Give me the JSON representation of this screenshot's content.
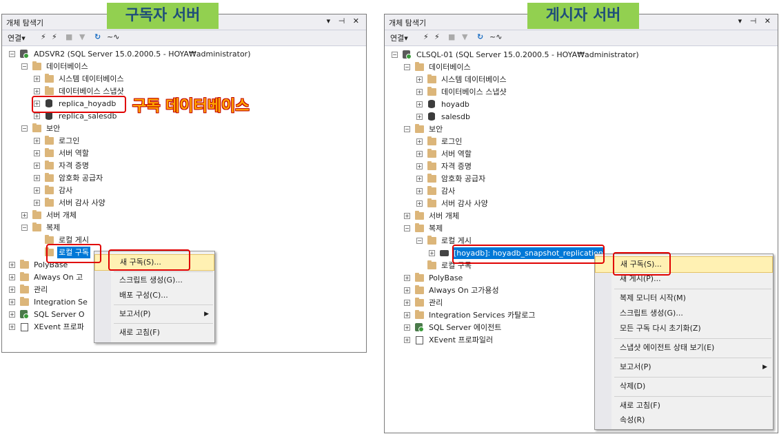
{
  "panel_title": "개체 탐색기",
  "panel_buttons": "▾ ⊣ ✕",
  "toolbar": {
    "connect": "연결▾",
    "icon1": "⚡",
    "icon2": "⚡",
    "refresh": "↻",
    "activity": "~∿"
  },
  "left": {
    "banner": "구독자 서버",
    "annotation": "구독 데이터베이스",
    "server": "ADSVR2 (SQL Server 15.0.2000.5 - HOYA₩administrator)",
    "databases": "데이터베이스",
    "system_db": "시스템 데이터베이스",
    "db_snapshot": "데이터베이스 스냅샷",
    "db1": "replica_hoyadb",
    "db2": "replica_salesdb",
    "security": "보안",
    "logins": "로그인",
    "server_roles": "서버 역할",
    "credentials": "자격 증명",
    "crypto": "암호화 공급자",
    "audit": "감사",
    "audit_spec": "서버 감사 사양",
    "server_objects": "서버 개체",
    "replication": "복제",
    "local_pub": "로컬 게시",
    "local_sub": "로컬 구독",
    "polybase": "PolyBase",
    "alwayson": "Always On 고",
    "management": "관리",
    "integration": "Integration Se",
    "agent": "SQL Server O",
    "xevent": "XEvent 프로파",
    "menu": {
      "new_sub": "새 구독(S)...",
      "script": "스크립트 생성(G)...",
      "deploy": "배포 구성(C)...",
      "reports": "보고서(P)",
      "refresh": "새로 고침(F)"
    }
  },
  "right": {
    "banner": "게시자 서버",
    "server": "CLSQL-01 (SQL Server 15.0.2000.5 - HOYA₩administrator)",
    "databases": "데이터베이스",
    "system_db": "시스템 데이터베이스",
    "db_snapshot": "데이터베이스 스냅샷",
    "db1": "hoyadb",
    "db2": "salesdb",
    "security": "보안",
    "logins": "로그인",
    "server_roles": "서버 역할",
    "credentials": "자격 증명",
    "crypto": "암호화 공급자",
    "audit": "감사",
    "audit_spec": "서버 감사 사양",
    "server_objects": "서버 개체",
    "replication": "복제",
    "local_pub": "로컬 게시",
    "publication": "[hoyadb]: hoyadb_snapshot_replication",
    "local_sub": "로컬 구독",
    "polybase": "PolyBase",
    "alwayson": "Always On 고가용성",
    "management": "관리",
    "integration": "Integration Services 카탈로그",
    "agent": "SQL Server 에이전트",
    "xevent": "XEvent 프로파일러",
    "menu": {
      "new_sub": "새 구독(S)...",
      "new_pub": "새 게시(P)...",
      "monitor": "복제 모니터 시작(M)",
      "script": "스크립트 생성(G)...",
      "reinit": "모든 구독 다시 초기화(Z)",
      "snapshot_agent": "스냅샷 에이전트 상태 보기(E)",
      "reports": "보고서(P)",
      "delete": "삭제(D)",
      "refresh": "새로 고침(F)",
      "properties": "속성(R)"
    }
  }
}
